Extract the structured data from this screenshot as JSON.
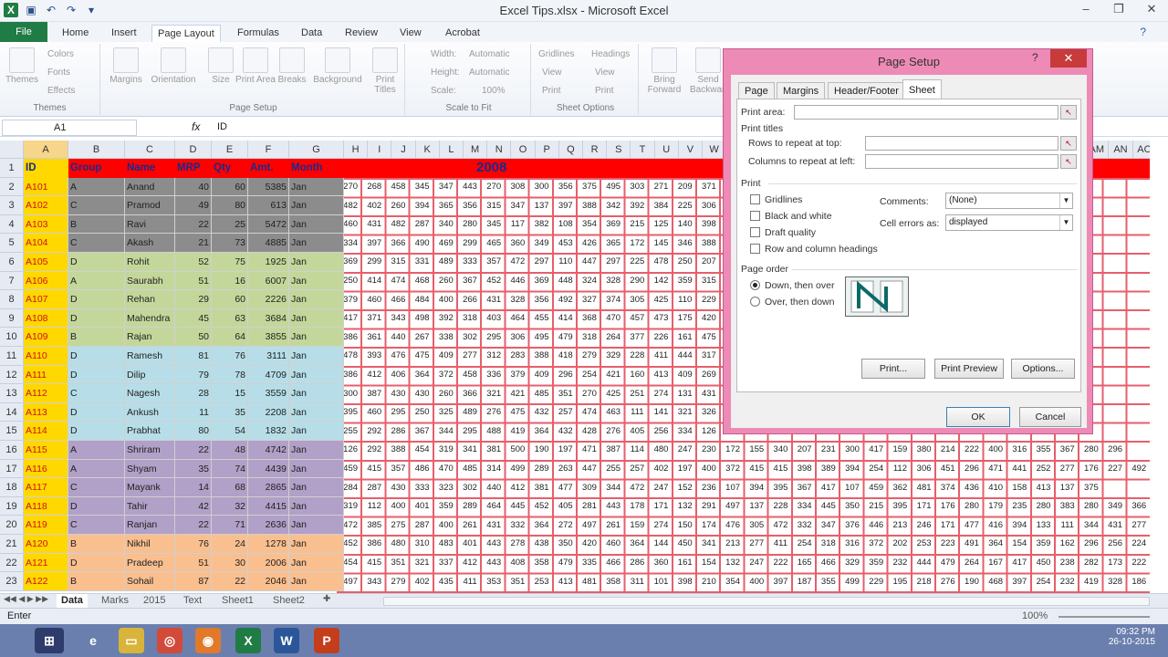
{
  "window": {
    "title": "Excel Tips.xlsx - Microsoft Excel"
  },
  "ribbon_tabs": [
    "File",
    "Home",
    "Insert",
    "Page Layout",
    "Formulas",
    "Data",
    "Review",
    "View",
    "Acrobat"
  ],
  "ribbon": {
    "themes": {
      "label": "Themes",
      "items": [
        "Themes",
        "Colors",
        "Fonts",
        "Effects"
      ]
    },
    "page_setup": {
      "label": "Page Setup",
      "items": [
        "Margins",
        "Orientation",
        "Size",
        "Print Area",
        "Breaks",
        "Background",
        "Print Titles"
      ]
    },
    "scale_to_fit": {
      "label": "Scale to Fit",
      "width_label": "Width:",
      "width_value": "Automatic",
      "height_label": "Height:",
      "height_value": "Automatic",
      "scale_label": "Scale:",
      "scale_value": "100%"
    },
    "sheet_options": {
      "label": "Sheet Options",
      "gridlines": "Gridlines",
      "headings": "Headings",
      "view": "View",
      "print": "Print"
    },
    "arrange": {
      "items": [
        "Bring Forward",
        "Send Backward"
      ]
    }
  },
  "formula_bar": {
    "name_box": "A1",
    "fx": "fx",
    "value": "ID"
  },
  "columns": [
    "A",
    "B",
    "C",
    "D",
    "E",
    "F",
    "G",
    "H",
    "I",
    "J",
    "K",
    "L",
    "M",
    "N",
    "O",
    "P",
    "Q",
    "R",
    "S",
    "T",
    "U",
    "V",
    "W",
    "X",
    "Y",
    "Z",
    "AA",
    "AB",
    "AC",
    "AD",
    "AE",
    "AF",
    "AG",
    "AH",
    "AI",
    "AJ",
    "AK",
    "AL",
    "AM",
    "AN",
    "AO"
  ],
  "header_row": {
    "row": "1",
    "cells": [
      "ID",
      "Group",
      "Name",
      "MRP",
      "Qty",
      "Amt.",
      "Month"
    ],
    "year": "2008"
  },
  "rows": [
    {
      "n": "2",
      "id": "A101",
      "group": "A",
      "name": "Anand",
      "mrp": "40",
      "qty": "60",
      "amt": "5385",
      "month": "Jan",
      "nums": "270 268 458 345 347 443 270 308 300 356 375 495 303 271 209 371 327 474 312 450 291 369 303 337 428 310 305 288 369"
    },
    {
      "n": "3",
      "id": "A102",
      "group": "C",
      "name": "Pramod",
      "mrp": "49",
      "qty": "80",
      "amt": "613",
      "month": "Jan",
      "nums": "482 402 260 394 365 356 315 347 137 397 388 342 392 384 225 306 350 387 465 377 322 356 381 317 292 290 288 365 439"
    },
    {
      "n": "4",
      "id": "A103",
      "group": "B",
      "name": "Ravi",
      "mrp": "22",
      "qty": "25",
      "amt": "5472",
      "month": "Jan",
      "nums": "460 431 482 287 340 280 345 117 382 108 354 369 215 125 140 398 389 433 367 405 357 244 440 305 410 319 298 228 175"
    },
    {
      "n": "5",
      "id": "A104",
      "group": "C",
      "name": "Akash",
      "mrp": "21",
      "qty": "73",
      "amt": "4885",
      "month": "Jan",
      "nums": "334 397 366 490 469 299 465 360 349 453 426 365 172 145 346 388 295 311 344 432 290 413 394 375 452 296 330 161 374"
    },
    {
      "n": "6",
      "id": "A105",
      "group": "D",
      "name": "Rohit",
      "mrp": "52",
      "qty": "75",
      "amt": "1925",
      "month": "Jan",
      "nums": "369 299 315 331 489 333 357 472 297 110 447 297 225 478 250 207 359 329 367 468 317 342 483 434 386 380 380 444 372"
    },
    {
      "n": "7",
      "id": "A106",
      "group": "A",
      "name": "Saurabh",
      "mrp": "51",
      "qty": "16",
      "amt": "6007",
      "month": "Jan",
      "nums": "250 414 474 468 260 367 452 446 369 448 324 328 290 142 359 315 301 380 312 470 432 354 396 362 438 401 336 233 157"
    },
    {
      "n": "8",
      "id": "A107",
      "group": "D",
      "name": "Rehan",
      "mrp": "29",
      "qty": "60",
      "amt": "2226",
      "month": "Jan",
      "nums": "379 460 466 484 400 266 431 328 356 492 327 374 305 425 110 229 297 418 335 457 380 313 375 358 325 374 392 299 444"
    },
    {
      "n": "9",
      "id": "A108",
      "group": "D",
      "name": "Mahendra",
      "mrp": "45",
      "qty": "63",
      "amt": "3684",
      "month": "Jan",
      "nums": "417 371 343 498 392 318 403 464 455 414 368 470 457 473 175 420 372 316 320 333 362 290 463 450 489 357 383 380 343"
    },
    {
      "n": "10",
      "id": "A109",
      "group": "B",
      "name": "Rajan",
      "mrp": "50",
      "qty": "64",
      "amt": "3855",
      "month": "Jan",
      "nums": "386 361 440 267 338 302 295 306 495 479 318 264 377 226 161 475 445 372 314 490 416 356 362 398 392 418 457 328 400"
    },
    {
      "n": "11",
      "id": "A110",
      "group": "D",
      "name": "Ramesh",
      "mrp": "81",
      "qty": "76",
      "amt": "3111",
      "month": "Jan",
      "nums": "478 393 476 475 409 277 312 283 388 418 279 329 228 411 444 317 393 317 377 374 386 470 396 290 373 318 338 260 499"
    },
    {
      "n": "12",
      "id": "A111",
      "group": "D",
      "name": "Dilip",
      "mrp": "79",
      "qty": "78",
      "amt": "4709",
      "month": "Jan",
      "nums": "386 412 406 364 372 458 336 379 409 296 254 421 160 413 409 269 494 370 291 362 479 337 410 349 396 358 346 497 311"
    },
    {
      "n": "13",
      "id": "A112",
      "group": "C",
      "name": "Nagesh",
      "mrp": "28",
      "qty": "15",
      "amt": "3559",
      "month": "Jan",
      "nums": "300 387 430 430 260 366 321 421 485 351 270 425 251 274 131 431 454 405 413 307 322 446 401 414 369 439 396 167 279"
    },
    {
      "n": "14",
      "id": "A113",
      "group": "D",
      "name": "Ankush",
      "mrp": "11",
      "qty": "35",
      "amt": "2208",
      "month": "Jan",
      "nums": "395 460 295 250 325 489 276 475 432 257 474 463 111 141 321 326 417 468 491 424 457 381 401 428 302 306 275 103 461"
    },
    {
      "n": "15",
      "id": "A114",
      "group": "D",
      "name": "Prabhat",
      "mrp": "80",
      "qty": "54",
      "amt": "1832",
      "month": "Jan",
      "nums": "255 292 286 367 344 295 488 419 364 432 428 276 405 256 334 126 479 415 376 421 428 327 477 425 440 291 474 183 389"
    },
    {
      "n": "16",
      "id": "A115",
      "group": "A",
      "name": "Shriram",
      "mrp": "22",
      "qty": "48",
      "amt": "4742",
      "month": "Jan",
      "nums": "126 292 388 454 319 341 381 500 190 197 471 387 114 480 247 230 172 155 340 207 231 300 417 159 380 214 222 400 316 355 367 280 296"
    },
    {
      "n": "17",
      "id": "A116",
      "group": "A",
      "name": "Shyam",
      "mrp": "35",
      "qty": "74",
      "amt": "4439",
      "month": "Jan",
      "nums": "459 415 357 486 470 485 314 499 289 263 447 255 257 402 197 400 372 415 415 398 389 394 254 112 306 451 296 471 441 252 277 176 227 492"
    },
    {
      "n": "18",
      "id": "A117",
      "group": "C",
      "name": "Mayank",
      "mrp": "14",
      "qty": "68",
      "amt": "2865",
      "month": "Jan",
      "nums": "284 287 430 333 323 302 440 412 381 477 309 344 472 247 152 236 107 394 395 367 417 107 459 362 481 374 436 410 158 413 137 375"
    },
    {
      "n": "19",
      "id": "A118",
      "group": "D",
      "name": "Tahir",
      "mrp": "42",
      "qty": "32",
      "amt": "4415",
      "month": "Jan",
      "nums": "319 112 400 401 359 289 464 445 452 405 281 443 178 171 132 291 497 137 228 334 445 350 215 395 171 176 280 179 235 280 383 280 349 366"
    },
    {
      "n": "20",
      "id": "A119",
      "group": "C",
      "name": "Ranjan",
      "mrp": "22",
      "qty": "71",
      "amt": "2636",
      "month": "Jan",
      "nums": "472 385 275 287 400 261 431 332 364 272 497 261 159 274 150 174 476 305 472 332 347 376 446 213 246 171 477 416 394 133 111 344 431 277"
    },
    {
      "n": "21",
      "id": "A120",
      "group": "B",
      "name": "Nikhil",
      "mrp": "76",
      "qty": "24",
      "amt": "1278",
      "month": "Jan",
      "nums": "452 386 480 310 483 401 443 278 438 350 420 460 364 144 450 341 213 277 411 254 318 316 372 202 253 223 491 364 154 359 162 296 256 224"
    },
    {
      "n": "22",
      "id": "A121",
      "group": "D",
      "name": "Pradeep",
      "mrp": "51",
      "qty": "30",
      "amt": "2006",
      "month": "Jan",
      "nums": "454 415 351 321 337 412 443 408 358 479 335 466 286 360 161 154 132 247 222 165 466 329 359 232 444 479 264 167 417 450 238 282 173 222"
    },
    {
      "n": "23",
      "id": "A122",
      "group": "B",
      "name": "Sohail",
      "mrp": "87",
      "qty": "22",
      "amt": "2046",
      "month": "Jan",
      "nums": "497 343 279 402 435 411 353 351 253 413 481 358 311 101 398 210 354 400 397 187 355 499 229 195 218 276 190 468 397 254 232 419 328 186"
    }
  ],
  "sheet_tabs": [
    "Data",
    "Marks",
    "2015",
    "Text",
    "Sheet1",
    "Sheet2"
  ],
  "status": {
    "mode": "Enter",
    "zoom": "100%"
  },
  "taskbar": {
    "time": "09:32 PM",
    "date": "26-10-2015"
  },
  "dialog": {
    "title": "Page Setup",
    "help": "?",
    "close": "✕",
    "tabs": [
      "Page",
      "Margins",
      "Header/Footer",
      "Sheet"
    ],
    "print_area_label": "Print area:",
    "print_titles_label": "Print titles",
    "rows_repeat_label": "Rows to repeat at top:",
    "cols_repeat_label": "Columns to repeat at left:",
    "print_label": "Print",
    "gridlines": "Gridlines",
    "black_white": "Black and white",
    "draft_quality": "Draft quality",
    "row_col_headings": "Row and column headings",
    "comments_label": "Comments:",
    "comments_value": "(None)",
    "cell_errors_label": "Cell errors as:",
    "cell_errors_value": "displayed",
    "page_order_label": "Page order",
    "down_over": "Down, then over",
    "over_down": "Over, then down",
    "print_btn": "Print...",
    "preview_btn": "Print Preview",
    "options_btn": "Options...",
    "ok_btn": "OK",
    "cancel_btn": "Cancel"
  },
  "colors": {
    "header_red": "#ff0000",
    "id_yellow": "#ffd800",
    "gray": "#8c8c8c",
    "green": "#c4d79b",
    "blue": "#b7dee8",
    "purple": "#b1a0c7",
    "orange": "#fabf8f",
    "dialog_border": "#ee8ab6"
  }
}
